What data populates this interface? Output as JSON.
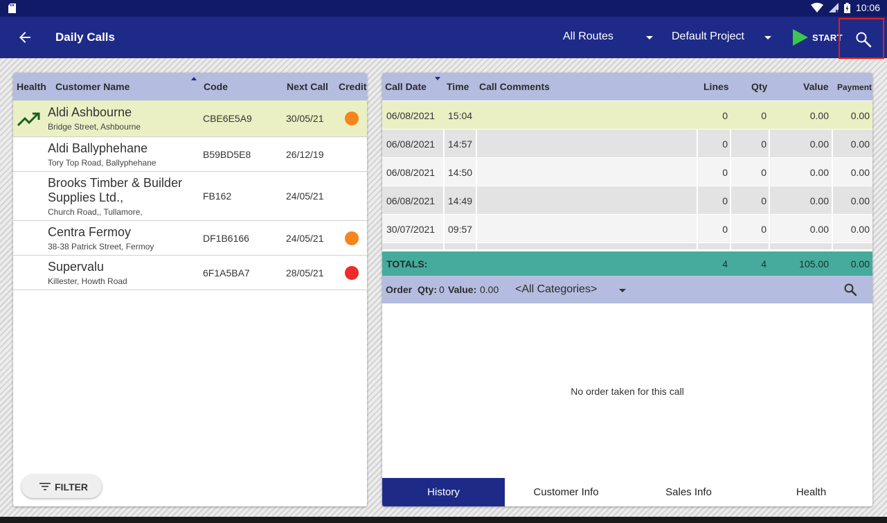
{
  "status_bar": {
    "time": "10:06"
  },
  "app_bar": {
    "title": "Daily Calls",
    "routes_label": "All Routes",
    "project_label": "Default Project",
    "start_label": "START"
  },
  "customers": {
    "columns": {
      "health": "Health",
      "name": "Customer Name",
      "code": "Code",
      "next_call": "Next Call",
      "credit": "Credit"
    },
    "rows": [
      {
        "name": "Aldi Ashbourne",
        "address": "Bridge Street, Ashbourne",
        "code": "CBE6E5A9",
        "next_call": "30/05/21",
        "credit_color": "#f7841c",
        "health": "trending-up-icon"
      },
      {
        "name": "Aldi Ballyphehane",
        "address": "Tory Top Road, Ballyphehane",
        "code": "B59BD5E8",
        "next_call": "26/12/19"
      },
      {
        "name": "Brooks Timber & Builder Supplies Ltd.,",
        "address": "Church Road,, Tullamore,",
        "code": "FB162",
        "next_call": "24/05/21"
      },
      {
        "name": "Centra Fermoy",
        "address": "38-38 Patrick Street, Fermoy",
        "code": "DF1B6166",
        "next_call": "24/05/21",
        "credit_color": "#f7841c"
      },
      {
        "name": "Supervalu",
        "address": "Killester, Howth Road",
        "code": "6F1A5BA7",
        "next_call": "28/05/21",
        "credit_color": "#ee2a2a"
      }
    ],
    "filter_label": "FILTER"
  },
  "history": {
    "columns": {
      "call_date": "Call Date",
      "time": "Time",
      "comments": "Call Comments",
      "lines": "Lines",
      "qty": "Qty",
      "value": "Value",
      "payment": "Payment"
    },
    "rows": [
      {
        "date": "06/08/2021",
        "time": "15:04",
        "comments": "",
        "lines": "0",
        "qty": "0",
        "value": "0.00",
        "payment": "0.00"
      },
      {
        "date": "06/08/2021",
        "time": "14:57",
        "comments": "",
        "lines": "0",
        "qty": "0",
        "value": "0.00",
        "payment": "0.00"
      },
      {
        "date": "06/08/2021",
        "time": "14:50",
        "comments": "",
        "lines": "0",
        "qty": "0",
        "value": "0.00",
        "payment": "0.00"
      },
      {
        "date": "06/08/2021",
        "time": "14:49",
        "comments": "",
        "lines": "0",
        "qty": "0",
        "value": "0.00",
        "payment": "0.00"
      },
      {
        "date": "30/07/2021",
        "time": "09:57",
        "comments": "",
        "lines": "0",
        "qty": "0",
        "value": "0.00",
        "payment": "0.00"
      }
    ],
    "totals": {
      "label": "TOTALS:",
      "lines": "4",
      "qty": "4",
      "value": "105.00",
      "payment": "0.00"
    }
  },
  "order": {
    "order_label": "Order",
    "qty_label": "Qty:",
    "qty_value": "0",
    "value_label": "Value:",
    "value_value": "0.00",
    "category": "<All Categories>",
    "empty_message": "No order taken for this call"
  },
  "tabs": [
    "History",
    "Customer Info",
    "Sales Info",
    "Health"
  ],
  "colors": {
    "primary": "#1e2a87",
    "header": "#b4bddf",
    "selected": "#eaf0c4",
    "totals": "#46ab9c",
    "start": "#3ec64a",
    "highlight": "#e0201c"
  }
}
